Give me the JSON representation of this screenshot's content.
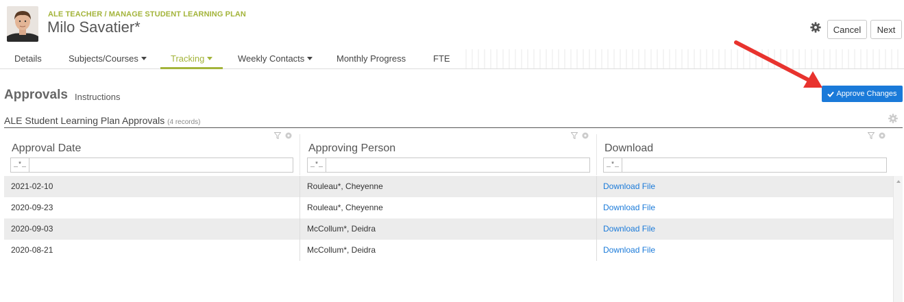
{
  "header": {
    "breadcrumb": "ALE TEACHER / MANAGE STUDENT LEARNING PLAN",
    "student_name": "Milo Savatier*",
    "cancel_label": "Cancel",
    "next_label": "Next"
  },
  "tabs": [
    {
      "label": "Details",
      "dropdown": false,
      "active": false
    },
    {
      "label": "Subjects/Courses",
      "dropdown": true,
      "active": false
    },
    {
      "label": "Tracking",
      "dropdown": true,
      "active": true
    },
    {
      "label": "Weekly Contacts",
      "dropdown": true,
      "active": false
    },
    {
      "label": "Monthly Progress",
      "dropdown": false,
      "active": false
    },
    {
      "label": "FTE",
      "dropdown": false,
      "active": false
    }
  ],
  "section": {
    "title": "Approvals",
    "instructions_label": "Instructions",
    "approve_label": "Approve Changes"
  },
  "grid": {
    "title": "ALE Student Learning Plan Approvals",
    "records_label": "(4 records)",
    "filter_op": "_*_",
    "columns": [
      {
        "label": "Approval Date"
      },
      {
        "label": "Approving Person"
      },
      {
        "label": "Download"
      }
    ],
    "rows": [
      {
        "date": "2021-02-10",
        "person": "Rouleau*, Cheyenne",
        "download": "Download File"
      },
      {
        "date": "2020-09-23",
        "person": "Rouleau*, Cheyenne",
        "download": "Download File"
      },
      {
        "date": "2020-09-03",
        "person": "McCollum*, Deidra",
        "download": "Download File"
      },
      {
        "date": "2020-08-21",
        "person": "McCollum*, Deidra",
        "download": "Download File"
      }
    ]
  },
  "colors": {
    "accent": "#a3b43a",
    "primary": "#1a7ad9",
    "arrow": "#e8332e"
  }
}
